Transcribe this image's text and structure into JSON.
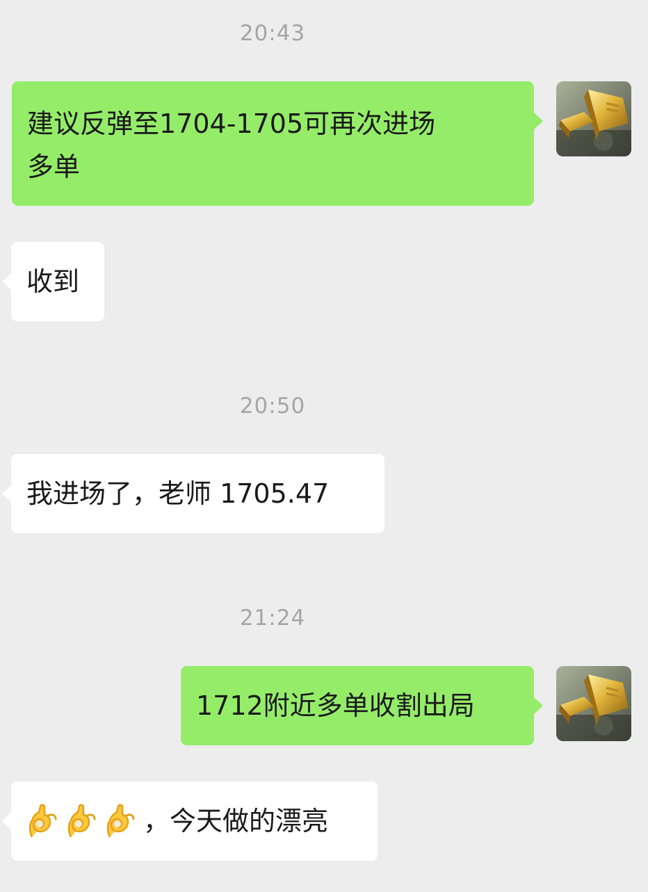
{
  "chat": {
    "messages": [
      {
        "type": "time",
        "text": "20:43"
      },
      {
        "type": "outgoing",
        "text": "建议反弹至1704-1705可再次进场多单",
        "line1": "建议反弹至1704-1705可再次进场",
        "line2": "多单",
        "avatar_icon": "gold-bars-avatar-icon"
      },
      {
        "type": "incoming",
        "text": "收到"
      },
      {
        "type": "time",
        "text": "20:50"
      },
      {
        "type": "incoming",
        "text": "我进场了，老师 1705.47"
      },
      {
        "type": "time",
        "text": "21:24"
      },
      {
        "type": "outgoing",
        "text": "1712附近多单收割出局",
        "avatar_icon": "gold-bars-avatar-icon"
      },
      {
        "type": "incoming",
        "emoji_icon": "ok-hand-icon",
        "emoji_count": 3,
        "text": "，今天做的漂亮"
      }
    ]
  },
  "colors": {
    "background": "#ededed",
    "outgoing_bubble": "#95ec69",
    "incoming_bubble": "#ffffff",
    "timestamp_text": "#a5a5a5",
    "message_text": "#191919"
  }
}
